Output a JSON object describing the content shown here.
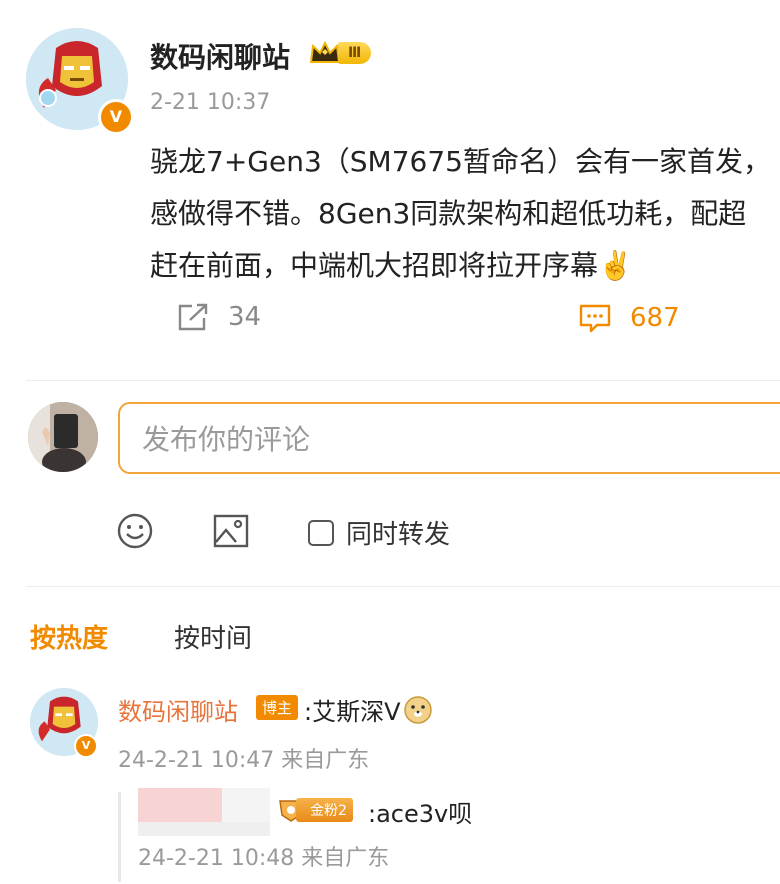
{
  "post": {
    "author": "数码闲聊站",
    "level_badge": "Ⅲ",
    "time": "2-21 10:37",
    "lines": [
      "骁龙7+Gen3（SM7675暂命名）会有一家首发，",
      "感做得不错。8Gen3同款架构和超低功耗，配超",
      "赶在前面，中端机大招即将拉开序幕✌️"
    ],
    "repost_count": "34",
    "comment_count": "687"
  },
  "composer": {
    "placeholder": "发布你的评论",
    "forward_label": "同时转发"
  },
  "sort_tabs": {
    "hot": "按热度",
    "time": "按时间"
  },
  "comment": {
    "author": "数码闲聊站",
    "tag": "博主",
    "text": ":艾斯深V",
    "time": "24-2-21 10:47 来自广东",
    "reply": {
      "fan_badge": "金粉2",
      "text": ":ace3v呗",
      "time": "24-2-21 10:48 来自广东"
    }
  },
  "colors": {
    "accent": "#f28a00",
    "name_orange": "#e8743b",
    "muted": "#9a9a9a"
  }
}
